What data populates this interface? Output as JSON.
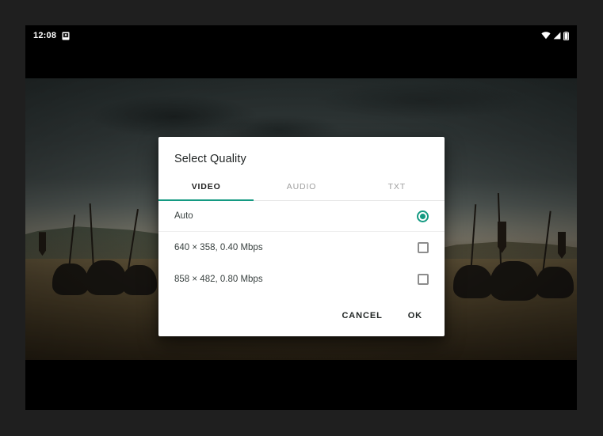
{
  "device": {
    "status_bar": {
      "clock": "12:08",
      "left_icons": [
        {
          "name": "screenshot-icon",
          "glyph": "▣"
        }
      ],
      "right_icons": [
        {
          "name": "wifi-icon",
          "glyph": "▼"
        },
        {
          "name": "cellular-signal-icon",
          "glyph": "◢"
        },
        {
          "name": "battery-icon",
          "glyph": "▯"
        }
      ]
    }
  },
  "video": {
    "description": "Medieval knights on horseback with banners under a dark stormy sky"
  },
  "dialog": {
    "title": "Select Quality",
    "accent_color": "#149a82",
    "tabs": [
      {
        "label": "VIDEO",
        "active": true
      },
      {
        "label": "AUDIO",
        "active": false
      },
      {
        "label": "TXT",
        "active": false
      }
    ],
    "options": [
      {
        "label": "Auto",
        "control": "radio",
        "selected": true
      },
      {
        "label": "640 × 358, 0.40 Mbps",
        "control": "checkbox",
        "selected": false
      },
      {
        "label": "858 × 482, 0.80 Mbps",
        "control": "checkbox",
        "selected": false
      }
    ],
    "actions": {
      "cancel_label": "CANCEL",
      "ok_label": "OK"
    }
  }
}
